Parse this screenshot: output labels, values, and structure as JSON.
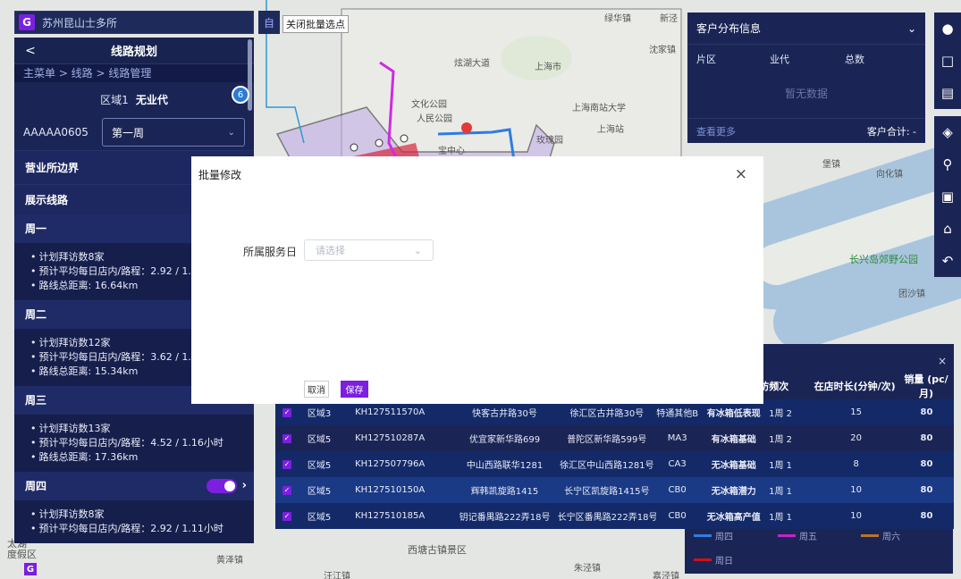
{
  "header": {
    "title": "苏州昆山士多所",
    "close_batch_label": "关闭批量选点",
    "select_icon": "自"
  },
  "route_panel": {
    "back": "<",
    "title": "线路规划",
    "breadcrumb": "主菜单 > 线路 > 线路管理",
    "region_label": "区域1",
    "region_value": "无业代",
    "route_code": "AAAAA0605",
    "week_select": "第一周",
    "badge": "6",
    "section_boundary": "营业所边界",
    "section_routes": "展示线路",
    "days": [
      {
        "name": "周一",
        "lines": [
          "计划拜访数8家",
          "预计平均每日店内/路程：2.92 / 1.1",
          "路线总距离: 16.64km"
        ]
      },
      {
        "name": "周二",
        "lines": [
          "计划拜访数12家",
          "预计平均每日店内/路程：3.62 / 1.0",
          "路线总距离: 15.34km"
        ]
      },
      {
        "name": "周三",
        "lines": [
          "计划拜访数13家",
          "预计平均每日店内/路程：4.52 / 1.16小时",
          "路线总距离: 17.36km"
        ]
      },
      {
        "name": "周四",
        "lines": [
          "计划拜访数8家",
          "预计平均每日店内/路程：2.92 / 1.11小时"
        ]
      }
    ]
  },
  "customer_panel": {
    "title": "客户分布信息",
    "cols": [
      "片区",
      "业代",
      "总数"
    ],
    "empty": "暂无数据",
    "more": "查看更多",
    "total": "客户合计: -"
  },
  "table": {
    "headers": {
      "freq": "访频次",
      "duration": "在店时长(分钟/次)",
      "sales": "销量 (pc/月)"
    },
    "close": "×",
    "rows": [
      {
        "area": "区域3",
        "code": "KH127511570A",
        "name": "快客古井路30号",
        "addr": "徐汇区古井路30号",
        "type": "特通其他B",
        "tag": "有冰箱低表现",
        "freq": "1周 2",
        "dur": "15",
        "sales": "80"
      },
      {
        "area": "区域5",
        "code": "KH127510287A",
        "name": "优宜家新华路699",
        "addr": "普陀区新华路599号",
        "type": "MA3",
        "tag": "有冰箱基础",
        "freq": "1周 2",
        "dur": "20",
        "sales": "80"
      },
      {
        "area": "区域5",
        "code": "KH127507796A",
        "name": "中山西路联华1281",
        "addr": "徐汇区中山西路1281号",
        "type": "CA3",
        "tag": "无冰箱基础",
        "freq": "1周 1",
        "dur": "8",
        "sales": "80"
      },
      {
        "area": "区域5",
        "code": "KH127510150A",
        "name": "辉韩凯旋路1415",
        "addr": "长宁区凯旋路1415号",
        "type": "CB0",
        "tag": "无冰箱潜力",
        "freq": "1周 1",
        "dur": "10",
        "sales": "80"
      },
      {
        "area": "区域5",
        "code": "KH127510185A",
        "name": "钥记番禺路222弄18号",
        "addr": "长宁区番禺路222弄18号",
        "type": "CB0",
        "tag": "无冰箱高产值",
        "freq": "1周 1",
        "dur": "10",
        "sales": "80"
      }
    ]
  },
  "legend": {
    "thu": {
      "label": "周四",
      "color": "#2d7de0"
    },
    "fri": {
      "label": "周五",
      "color": "#c026c9"
    },
    "sat": {
      "label": "周六",
      "color": "#b8742a"
    },
    "sun": {
      "label": "周日",
      "color": "#d0101a"
    }
  },
  "map_labels": [
    "绿华镇",
    "新泾",
    "沈家镇",
    "炫湖大道",
    "堡镇",
    "向化镇",
    "长兴岛郊野公园",
    "团沙镇",
    "西塘古镇景区",
    "朱泾镇",
    "嘉泾镇",
    "太湖",
    "度假区",
    "黄泽镇",
    "汪江镇",
    "上海南站大学",
    "玫瑰园",
    "上海站",
    "宝中心",
    "上海市",
    "人民公园",
    "文化公园"
  ],
  "modal": {
    "title": "批量修改",
    "close": "×",
    "field_label": "所属服务日",
    "field_placeholder": "请选择",
    "cancel": "取消",
    "save": "保存"
  },
  "logo_letter": "G"
}
